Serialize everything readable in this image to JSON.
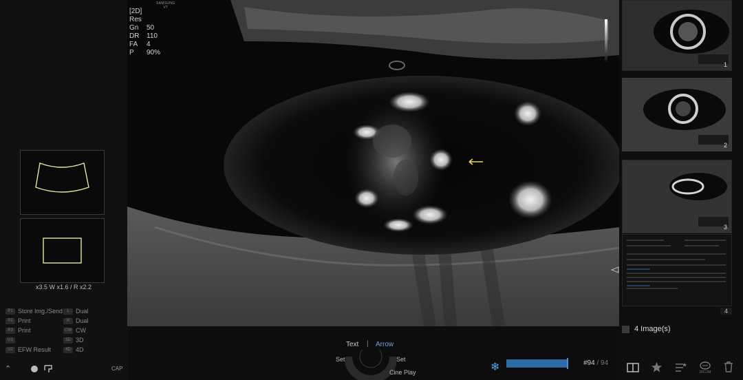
{
  "main_image": {
    "mode": "[2D]",
    "logo": {
      "line1": "SAMSUNG",
      "line2": "V7"
    },
    "params": [
      {
        "key": "Res",
        "value": ""
      },
      {
        "key": "Gn",
        "value": "50"
      },
      {
        "key": "DR",
        "value": "110"
      },
      {
        "key": "FA",
        "value": "4"
      },
      {
        "key": "P",
        "value": "90%"
      }
    ]
  },
  "left_panel": {
    "zoom_readout": "x3.5 W x1.6 / R x2.2",
    "keys": [
      {
        "badge": "P1",
        "label": "Store Img./Send"
      },
      {
        "badge": "P2",
        "label": "Print"
      },
      {
        "badge": "P3",
        "label": "Print"
      },
      {
        "badge": "U1",
        "label": ""
      },
      {
        "badge": "U2",
        "label": "EFW Result"
      }
    ],
    "mode_keys": [
      {
        "badge": "L",
        "label": "Dual"
      },
      {
        "badge": "R",
        "label": "Dual"
      },
      {
        "badge": "CW",
        "label": "CW"
      },
      {
        "badge": "3D",
        "label": "3D"
      },
      {
        "badge": "4D",
        "label": "4D"
      }
    ],
    "cap_label": "CAP"
  },
  "right_panel": {
    "thumbnails": [
      {
        "num": "1"
      },
      {
        "num": "2"
      },
      {
        "num": "3"
      }
    ],
    "page_indicator": "4",
    "image_count": "4 Image(s)"
  },
  "bottom": {
    "text_label": "Text",
    "separator": "|",
    "arrow_label": "Arrow",
    "set_left": "Set",
    "set_right": "Set",
    "cine_play": "Cine Play",
    "cine_progress": 0.98,
    "frame_current": "#94",
    "frame_total": "94"
  },
  "colors": {
    "accent": "#6fa4d6",
    "freeze": "#4aa0ec",
    "trace": "#e8e6a0",
    "arrow_marker": "#e6d86a"
  },
  "icons": [
    "chevron-up-icon",
    "record-dot-icon",
    "transducer-icon",
    "snowflake-icon",
    "dual-layout-icon",
    "star-icon",
    "annotation-list-icon",
    "dicom-icon",
    "trash-icon"
  ]
}
